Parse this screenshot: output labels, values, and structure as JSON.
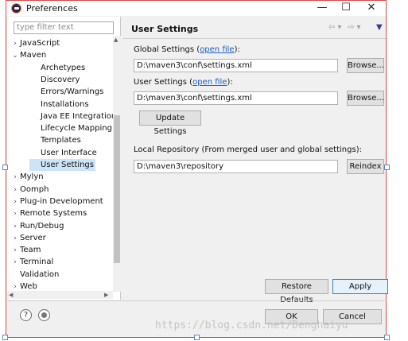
{
  "window": {
    "title": "Preferences",
    "controls": [
      "—",
      "☐",
      "✕"
    ]
  },
  "filter": {
    "placeholder": "type filter text"
  },
  "tree": [
    {
      "label": "JavaScript",
      "twisty": "›"
    },
    {
      "label": "Maven",
      "twisty": "⌄"
    },
    {
      "label": "Archetypes",
      "twisty": ""
    },
    {
      "label": "Discovery",
      "twisty": ""
    },
    {
      "label": "Errors/Warnings",
      "twisty": ""
    },
    {
      "label": "Installations",
      "twisty": ""
    },
    {
      "label": "Java EE Integration",
      "twisty": ""
    },
    {
      "label": "Lifecycle Mapping",
      "twisty": ""
    },
    {
      "label": "Templates",
      "twisty": ""
    },
    {
      "label": "User Interface",
      "twisty": ""
    },
    {
      "label": "User Settings",
      "twisty": ""
    },
    {
      "label": "Mylyn",
      "twisty": "›"
    },
    {
      "label": "Oomph",
      "twisty": "›"
    },
    {
      "label": "Plug-in Development",
      "twisty": "›"
    },
    {
      "label": "Remote Systems",
      "twisty": "›"
    },
    {
      "label": "Run/Debug",
      "twisty": "›"
    },
    {
      "label": "Server",
      "twisty": "›"
    },
    {
      "label": "Team",
      "twisty": "›"
    },
    {
      "label": "Terminal",
      "twisty": "›"
    },
    {
      "label": "Validation",
      "twisty": ""
    },
    {
      "label": "Web",
      "twisty": "›"
    }
  ],
  "page": {
    "title": "User Settings",
    "global_label_prefix": "Global Settings (",
    "global_link": "open file",
    "global_label_suffix": "):",
    "global_path": "D:\\maven3\\conf\\settings.xml",
    "user_label_prefix": "User Settings (",
    "user_link": "open file",
    "user_label_suffix": "):",
    "user_path": "D:\\maven3\\conf\\settings.xml",
    "browse": "Browse...",
    "update": "Update Settings",
    "local_repo_label": "Local Repository (From merged user and global settings):",
    "local_repo_path": "D:\\maven3\\repository",
    "reindex": "Reindex",
    "restore_defaults": "Restore Defaults",
    "apply": "Apply"
  },
  "footer": {
    "help_icon": "?",
    "ok": "OK",
    "cancel": "Cancel"
  },
  "watermark": "https://blog.csdn.net/Denghaiyu"
}
